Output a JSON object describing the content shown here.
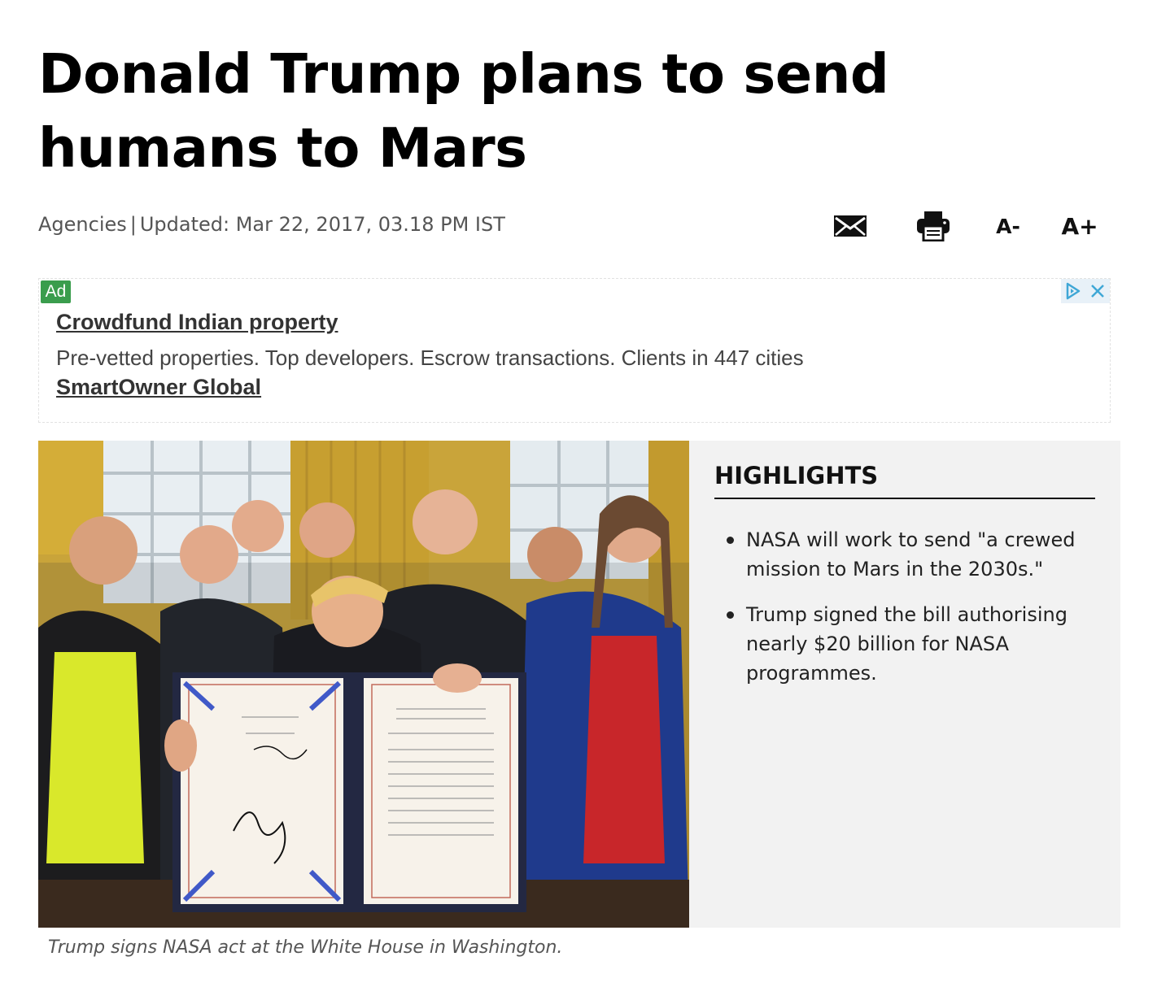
{
  "article": {
    "headline": "Donald Trump plans to send humans to Mars",
    "source": "Agencies",
    "separator": "|",
    "updated": "Updated: Mar 22, 2017, 03.18 PM IST"
  },
  "toolbar": {
    "email_icon": "mail-icon",
    "print_icon": "printer-icon",
    "font_decrease_label": "A-",
    "font_increase_label": "A+"
  },
  "ad": {
    "badge": "Ad",
    "title": "Crowdfund Indian property",
    "description": "Pre-vetted properties. Top developers. Escrow transactions. Clients in 447 cities",
    "sponsor": "SmartOwner Global",
    "adchoices_icon": "adchoices-icon",
    "close_icon": "close-icon",
    "badge_color": "#3a9d4d"
  },
  "photo": {
    "caption": "Trump signs NASA act at the White House in Washington."
  },
  "highlights": {
    "title": "HIGHLIGHTS",
    "items": [
      "NASA will work to send \"a crewed mission to Mars in the 2030s.\"",
      "Trump signed the bill authorising nearly $20 billion for NASA programmes."
    ]
  }
}
